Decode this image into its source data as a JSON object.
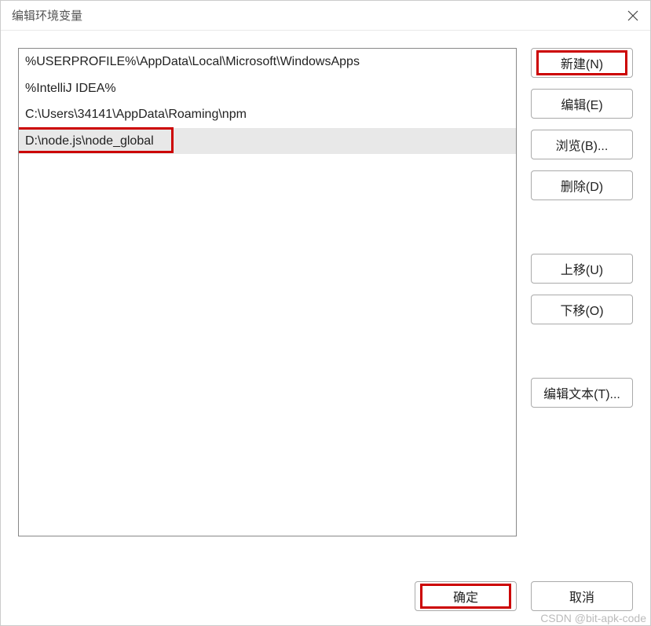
{
  "window": {
    "title": "编辑环境变量"
  },
  "list": {
    "items": [
      "%USERPROFILE%\\AppData\\Local\\Microsoft\\WindowsApps",
      "%IntelliJ IDEA%",
      "C:\\Users\\34141\\AppData\\Roaming\\npm",
      "D:\\node.js\\node_global"
    ],
    "selectedIndex": 3
  },
  "buttons": {
    "new": "新建(N)",
    "edit": "编辑(E)",
    "browse": "浏览(B)...",
    "delete": "删除(D)",
    "moveUp": "上移(U)",
    "moveDown": "下移(O)",
    "editText": "编辑文本(T)...",
    "ok": "确定",
    "cancel": "取消"
  },
  "watermark": "CSDN @bit-apk-code"
}
